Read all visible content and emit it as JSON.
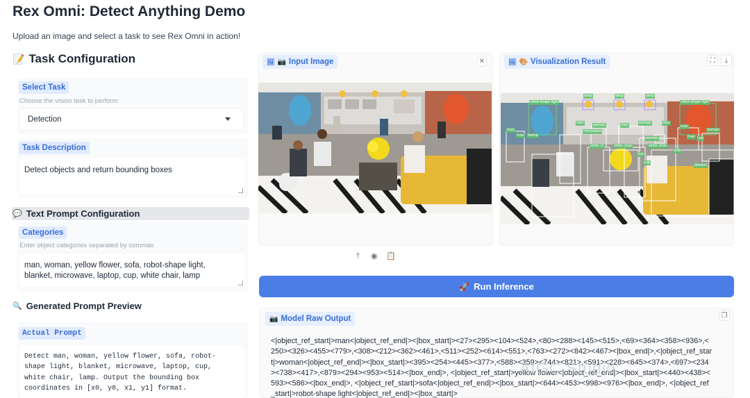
{
  "page": {
    "title": "Rex Omni: Detect Anything Demo",
    "subtitle": "Upload an image and select a task to see Rex Omni in action!"
  },
  "task_config": {
    "heading": "Task Configuration",
    "heading_icon": "memo-icon",
    "select_task_label": "Select Task",
    "select_task_hint": "Choose the vision task to perform",
    "selected_task": "Detection",
    "task_description_label": "Task Description",
    "task_description_value": "Detect objects and return bounding boxes"
  },
  "text_prompt": {
    "heading": "Text Prompt Configuration",
    "categories_label": "Categories",
    "categories_hint": "Enter object categories separated by commas",
    "categories_value": "man, woman, yellow flower, sofa, robot-shape light, blanket, microwave, laptop, cup, white chair, lamp"
  },
  "prompt_preview": {
    "heading": "Generated Prompt Preview",
    "actual_prompt_label": "Actual Prompt",
    "actual_prompt_value": "Detect man, woman, yellow flower, sofa, robot-shape light, blanket, microwave, laptop, cup, white chair, lamp. Output the bounding box coordinates in [x0, y0, x1, y1] format."
  },
  "input_panel": {
    "label": "Input Image"
  },
  "result_panel": {
    "label": "Visualization Result",
    "box_labels": [
      "lamp",
      "lamp",
      "lamp",
      "robot-shape light",
      "robot-shape light",
      "man",
      "man",
      "woman",
      "man",
      "woman",
      "man",
      "man",
      "microwave",
      "man",
      "laptop",
      "woman",
      "man",
      "woman",
      "white ch",
      "white chair",
      "white chair",
      "sofa",
      "cup",
      "cup",
      "cup",
      "blanket"
    ]
  },
  "run_button": {
    "label": "Run Inference"
  },
  "raw_output": {
    "label": "Model Raw Output",
    "value": "<|object_ref_start|>man<|object_ref_end|><|box_start|><27><295><104><524>,<80><288><145><515>,<69><364><358><936>,<250><326><455><779>,<308><212><362><461>,<511><252><614><551>,<763><272><842><467><|box_end|>,<|object_ref_start|>woman<|object_ref_end|><|box_start|><395><254><445><377>,<588><359><744><821>,<591><228><645><374>,<697><234><738><417>,<879><294><953><514><|box_end|>, <|object_ref_start|>yellow flower<|object_ref_end|><|box_start|><440><438><593><586><|box_end|>, <|object_ref_start|>sofa<|object_ref_end|><|box_start|><644><453><998><976><|box_end|>, <|object_ref_start|>robot-shape light<|object_ref_end|><|box_start|>"
  },
  "watermark": "AIGC Studio",
  "colors": {
    "accent": "#4a7de6",
    "tag_bg": "#e0ebff",
    "tag_text": "#3b6fd4"
  }
}
